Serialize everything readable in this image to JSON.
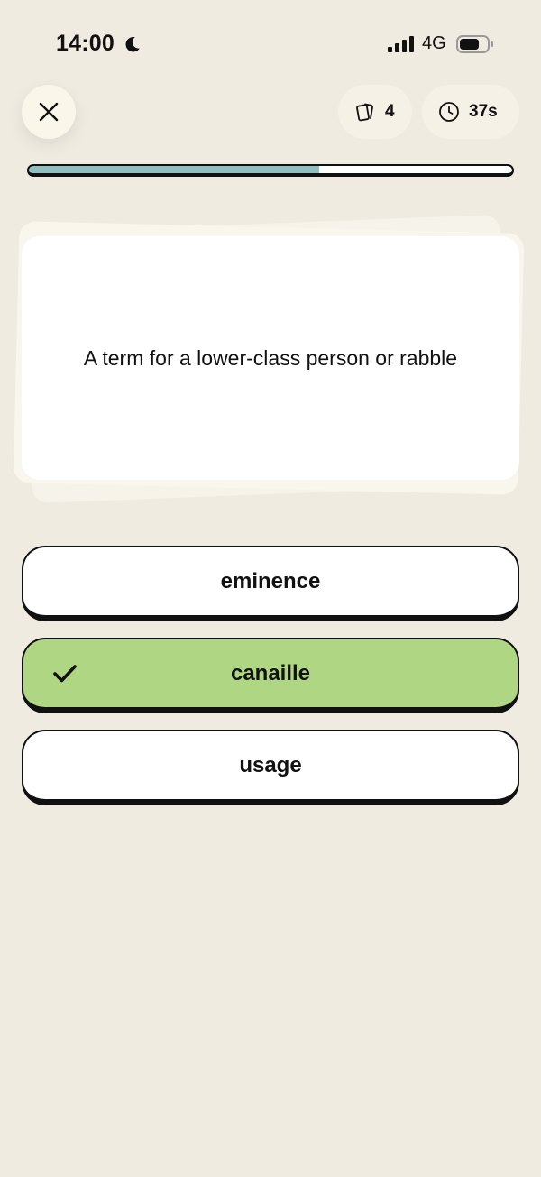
{
  "status_bar": {
    "time": "14:00",
    "network": "4G",
    "icons": [
      "moon-icon",
      "signal-icon",
      "battery-icon"
    ]
  },
  "header": {
    "close_icon": "close-icon",
    "cards_count": "4",
    "cards_icon": "cards-icon",
    "timer": "37s",
    "timer_icon": "clock-icon"
  },
  "progress": {
    "fraction": 0.6
  },
  "question": {
    "text": "A term for a lower-class person or rabble"
  },
  "answers": [
    {
      "label": "eminence",
      "state": "default"
    },
    {
      "label": "canaille",
      "state": "correct"
    },
    {
      "label": "usage",
      "state": "default"
    }
  ],
  "colors": {
    "background": "#efebe1",
    "progress_fill": "#8fbfbe",
    "correct": "#afd682",
    "border": "#111111"
  }
}
